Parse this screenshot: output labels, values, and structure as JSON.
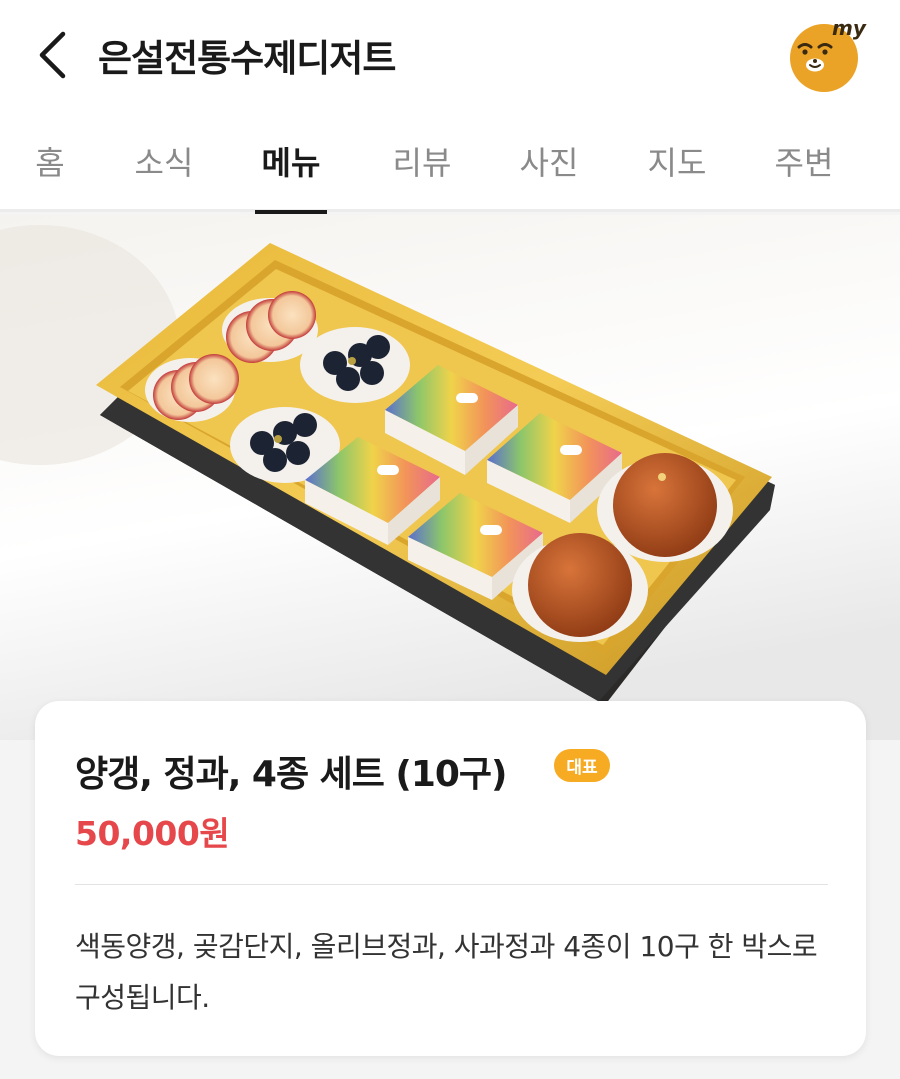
{
  "header": {
    "title": "은설전통수제디저트",
    "back_icon": "chevron-left-icon",
    "avatar_text": "my",
    "avatar_color": "#eaa326"
  },
  "tabs": [
    {
      "label": "홈",
      "active": false
    },
    {
      "label": "소식",
      "active": false
    },
    {
      "label": "메뉴",
      "active": true
    },
    {
      "label": "리뷰",
      "active": false
    },
    {
      "label": "사진",
      "active": false
    },
    {
      "label": "지도",
      "active": false
    },
    {
      "label": "주변",
      "active": false
    }
  ],
  "menu_item": {
    "name": "양갱, 정과, 4종 세트 (10구)",
    "badge": "대표",
    "badge_color": "#f6ab23",
    "price": "50,000원",
    "price_color": "#e5474b",
    "description": "색동양갱, 곶감단지, 올리브정과, 사과정과 4종이 10구 한 박스로 구성됩니다."
  }
}
